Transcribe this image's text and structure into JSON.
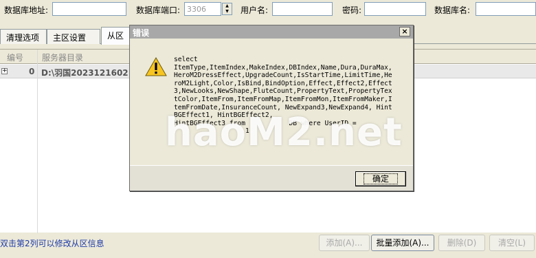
{
  "config": {
    "db_address_label": "数据库地址:",
    "db_address_value": "",
    "db_port_label": "数据库端口:",
    "db_port_value": "3306",
    "username_label": "用户名:",
    "username_value": "",
    "password_label": "密码:",
    "password_value": "",
    "db_name_label": "数据库名:",
    "db_name_value": ""
  },
  "tabs": [
    {
      "label": "清理选项"
    },
    {
      "label": "主区设置"
    },
    {
      "label": "从区"
    }
  ],
  "grid": {
    "col_id": "编号",
    "col_dir": "服务器目录",
    "rows": [
      {
        "expander": "+",
        "id": "0",
        "dir": "D:\\羽国2023121602"
      }
    ]
  },
  "footer": {
    "hint": "双击第2列可以修改从区信息",
    "add": "添加(A)...",
    "batch_add": "批量添加(A)...",
    "delete": "删除(D)",
    "clear": "清空(L)"
  },
  "dialog": {
    "title": "错误",
    "close": "×",
    "icon": "warning-icon",
    "message": "select\nItemType,ItemIndex,MakeIndex,DBIndex,Name,Dura,DuraMax,HeroM2DressEffect,UpgradeCount,IsStartTime,LimitTime,HeroM2Light,Color,IsBind,BindOption,Effect,Effect2,Effect3,NewLooks,NewShape,FluteCount,PropertyText,PropertyTextColor,ItemFrom,ItemFromMap,ItemFromMon,ItemFromMaker,ItemFromDate,InsuranceCount, NewExpand3,NewExpand4, HintBGEffect1, HintBGEffect2,\nHintBGEffect3 from           DB where UserID =\n                  1",
    "ok": "确定"
  },
  "watermark": "haoM2.net",
  "colors": {
    "window_bg": "#ece9d8",
    "dialog_title_bg": "#a8a8a8",
    "hint_text": "#1d3aa8",
    "warning_yellow": "#f7c521"
  }
}
